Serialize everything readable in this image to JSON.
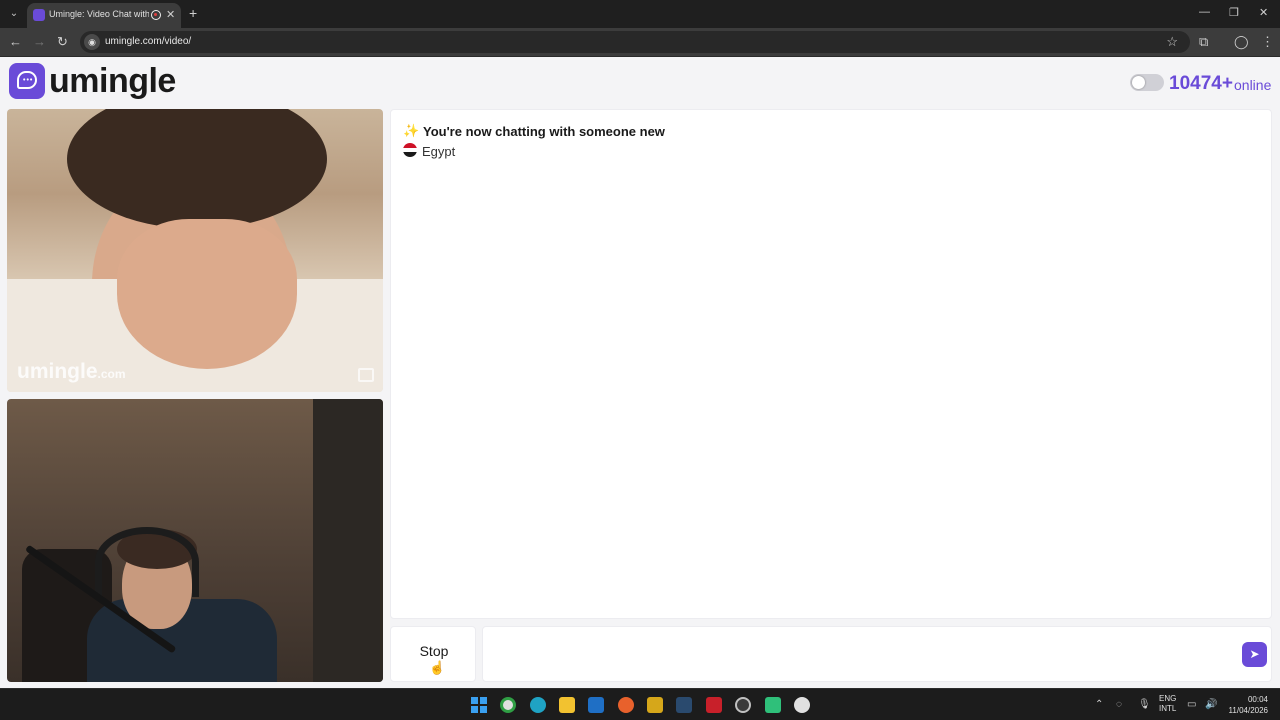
{
  "browser": {
    "tab_title": "Umingle: Video Chat with S",
    "url": "umingle.com/video/",
    "icons": [
      "tab-search-icon",
      "back-icon",
      "forward-icon",
      "reload-icon",
      "bookmark-star-icon",
      "extensions-icon",
      "profile-icon",
      "menu-icon"
    ]
  },
  "header": {
    "brand": "umingle",
    "online_count": "10474+",
    "online_label": "online"
  },
  "videos": {
    "watermark": "umingle",
    "watermark_suffix": ".com"
  },
  "chat": {
    "status_message": "You're now chatting with someone new",
    "country": "Egypt"
  },
  "controls": {
    "stop_label": "Stop",
    "message_value": ""
  },
  "taskbar": {
    "lang_line1": "ENG",
    "lang_line2": "INTL",
    "time": "00:04",
    "date": "11/04/2026"
  },
  "colors": {
    "brand": "#6a4bd8",
    "page_bg": "#f4f4f6"
  }
}
